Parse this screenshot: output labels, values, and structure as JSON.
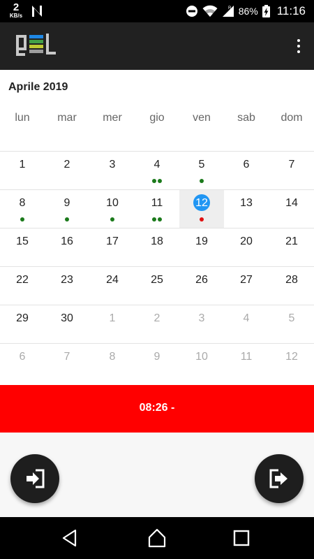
{
  "status_bar": {
    "net_speed_value": "2",
    "net_speed_unit": "KB/s",
    "battery_percent": "86%",
    "time": "11:16"
  },
  "calendar": {
    "month_title": "Aprile 2019",
    "weekdays": [
      "lun",
      "mar",
      "mer",
      "gio",
      "ven",
      "sab",
      "dom"
    ],
    "weeks": [
      [
        {
          "day": "1",
          "current_month": true,
          "dots": []
        },
        {
          "day": "2",
          "current_month": true,
          "dots": []
        },
        {
          "day": "3",
          "current_month": true,
          "dots": []
        },
        {
          "day": "4",
          "current_month": true,
          "dots": [
            "green",
            "green"
          ]
        },
        {
          "day": "5",
          "current_month": true,
          "dots": [
            "green"
          ]
        },
        {
          "day": "6",
          "current_month": true,
          "dots": []
        },
        {
          "day": "7",
          "current_month": true,
          "dots": []
        }
      ],
      [
        {
          "day": "8",
          "current_month": true,
          "dots": [
            "green"
          ]
        },
        {
          "day": "9",
          "current_month": true,
          "dots": [
            "green"
          ]
        },
        {
          "day": "10",
          "current_month": true,
          "dots": [
            "green"
          ]
        },
        {
          "day": "11",
          "current_month": true,
          "dots": [
            "green",
            "green"
          ]
        },
        {
          "day": "12",
          "current_month": true,
          "dots": [
            "red"
          ],
          "selected": true
        },
        {
          "day": "13",
          "current_month": true,
          "dots": []
        },
        {
          "day": "14",
          "current_month": true,
          "dots": []
        }
      ],
      [
        {
          "day": "15",
          "current_month": true,
          "dots": []
        },
        {
          "day": "16",
          "current_month": true,
          "dots": []
        },
        {
          "day": "17",
          "current_month": true,
          "dots": []
        },
        {
          "day": "18",
          "current_month": true,
          "dots": []
        },
        {
          "day": "19",
          "current_month": true,
          "dots": []
        },
        {
          "day": "20",
          "current_month": true,
          "dots": []
        },
        {
          "day": "21",
          "current_month": true,
          "dots": []
        }
      ],
      [
        {
          "day": "22",
          "current_month": true,
          "dots": []
        },
        {
          "day": "23",
          "current_month": true,
          "dots": []
        },
        {
          "day": "24",
          "current_month": true,
          "dots": []
        },
        {
          "day": "25",
          "current_month": true,
          "dots": []
        },
        {
          "day": "26",
          "current_month": true,
          "dots": []
        },
        {
          "day": "27",
          "current_month": true,
          "dots": []
        },
        {
          "day": "28",
          "current_month": true,
          "dots": []
        }
      ],
      [
        {
          "day": "29",
          "current_month": true,
          "dots": []
        },
        {
          "day": "30",
          "current_month": true,
          "dots": []
        },
        {
          "day": "1",
          "current_month": false,
          "dots": []
        },
        {
          "day": "2",
          "current_month": false,
          "dots": []
        },
        {
          "day": "3",
          "current_month": false,
          "dots": []
        },
        {
          "day": "4",
          "current_month": false,
          "dots": []
        },
        {
          "day": "5",
          "current_month": false,
          "dots": []
        }
      ],
      [
        {
          "day": "6",
          "current_month": false,
          "dots": []
        },
        {
          "day": "7",
          "current_month": false,
          "dots": []
        },
        {
          "day": "8",
          "current_month": false,
          "dots": []
        },
        {
          "day": "9",
          "current_month": false,
          "dots": []
        },
        {
          "day": "10",
          "current_month": false,
          "dots": []
        },
        {
          "day": "11",
          "current_month": false,
          "dots": []
        },
        {
          "day": "12",
          "current_month": false,
          "dots": []
        }
      ]
    ]
  },
  "time_bar": {
    "text": "08:26 -"
  },
  "actions": {
    "check_in_icon": "login-icon",
    "check_out_icon": "logout-icon"
  },
  "colors": {
    "app_bar": "#212121",
    "time_bar": "#ff0000",
    "selected_day": "#2196f3",
    "dot_green": "#1b7a1b",
    "dot_red": "#e01010",
    "fab": "#1e1e1e"
  }
}
